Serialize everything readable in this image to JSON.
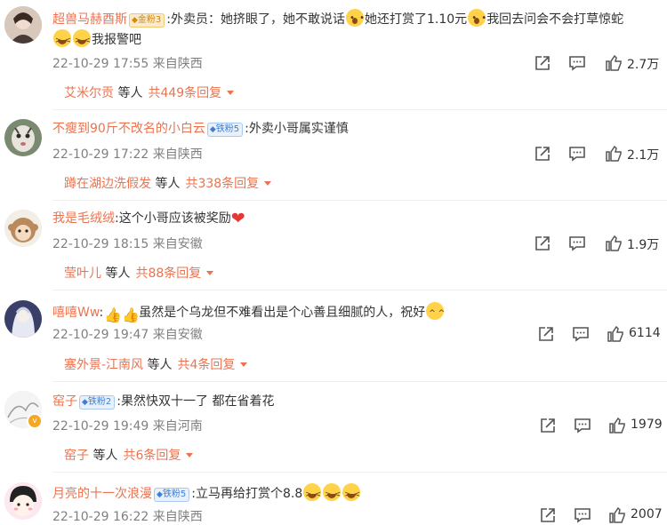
{
  "comments": [
    {
      "username": "超兽马赫酉斯",
      "badge": "金粉3",
      "text_parts": [
        ":外卖员：她挤眼了，她不敢说话",
        "她还打赏了1.10元",
        "我回去问会不会打草惊蛇"
      ],
      "text_line2": "我报警吧",
      "timestamp": "22-10-29 17:55",
      "location": "来自陕西",
      "likes": "2.7万",
      "reply_user": "艾米尔贡",
      "reply_mid": "等人",
      "reply_total": "共449条回复"
    },
    {
      "username": "不瘦到90斤不改名的小白云",
      "badge": "铁粉5",
      "text": ":外卖小哥属实谨慎",
      "timestamp": "22-10-29 17:22",
      "location": "来自陕西",
      "likes": "2.1万",
      "reply_user": "蹲在湖边洗假发",
      "reply_mid": "等人",
      "reply_total": "共338条回复"
    },
    {
      "username": "我是毛绒绒",
      "text": ":这个小哥应该被奖励",
      "timestamp": "22-10-29 18:15",
      "location": "来自安徽",
      "likes": "1.9万",
      "reply_user": "莹叶儿",
      "reply_mid": "等人",
      "reply_total": "共88条回复"
    },
    {
      "username": "嘻嘻Ww",
      "text_prefix": ":",
      "text": "虽然是个乌龙但不难看出是个心善且细腻的人，祝好",
      "timestamp": "22-10-29 19:47",
      "location": "来自安徽",
      "likes": "6114",
      "reply_user": "塞外景-江南风",
      "reply_mid": "等人",
      "reply_total": "共4条回复"
    },
    {
      "username": "窑子",
      "badge": "铁粉2",
      "text": ":果然快双十一了 都在省着花",
      "timestamp": "22-10-29 19:49",
      "location": "来自河南",
      "likes": "1979",
      "reply_user": "窑子",
      "reply_mid": "等人",
      "reply_total": "共6条回复"
    },
    {
      "username": "月亮的十一次浪漫",
      "badge": "铁粉5",
      "text": ":立马再给打赏个8.8",
      "timestamp": "22-10-29 16:22",
      "location": "来自陕西",
      "likes": "2007"
    }
  ],
  "icons": {
    "share": "share-icon",
    "comment": "comment-icon",
    "like": "thumbs-up-icon",
    "emoji_shock": "shocked-emoji-icon",
    "emoji_cry": "crying-emoji-icon",
    "emoji_thumb": "thumbs-up-emoji-icon",
    "emoji_cheers": "celebrate-emoji-icon",
    "heart": "heart-icon"
  },
  "colors": {
    "username": "#eb7350",
    "meta": "#808080",
    "text": "#333333"
  }
}
